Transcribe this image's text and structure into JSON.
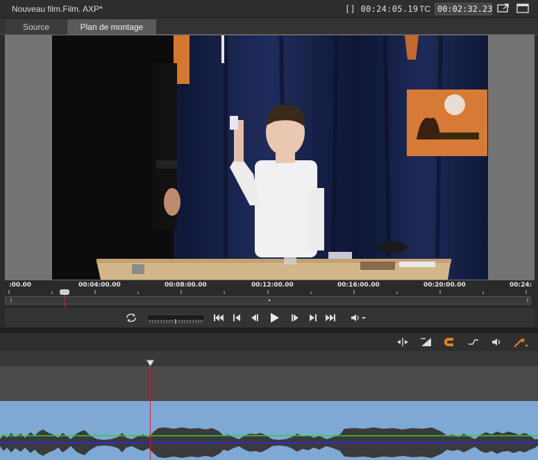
{
  "titlebar": {
    "title": "Nouveau film.Film. AXP*",
    "duration": "[] 00:24:05.19",
    "tc_label": "TC",
    "tc_value": "00:02:32.23"
  },
  "tabs": [
    {
      "label": "Source",
      "active": false
    },
    {
      "label": "Plan de montage",
      "active": true
    }
  ],
  "ruler": {
    "labels": [
      ":00.00",
      "00:04:00.00",
      "00:08:00.00",
      "00:12:00.00",
      "00:16:00.00",
      "00:20:00.00",
      "00:24:"
    ],
    "playhead_time": "00:02:32.23"
  },
  "transport": {
    "icons": [
      "loop-icon",
      "shuttle-control",
      "go-to-start-icon",
      "previous-frame-icon",
      "step-back-icon",
      "play-icon",
      "step-forward-icon",
      "next-frame-icon",
      "go-to-end-icon",
      "volume-icon"
    ]
  },
  "timeline_tools": [
    "split-icon",
    "ripple-icon",
    "magnet-icon",
    "trim-icon",
    "audio-scrub-icon",
    "magic-wand-icon"
  ],
  "colors": {
    "accent": "#e8821c",
    "playhead": "#d02020",
    "audio_track": "#7fa9d4",
    "waveform": "#3a3a3a",
    "volume_line": "#2ecc40"
  }
}
